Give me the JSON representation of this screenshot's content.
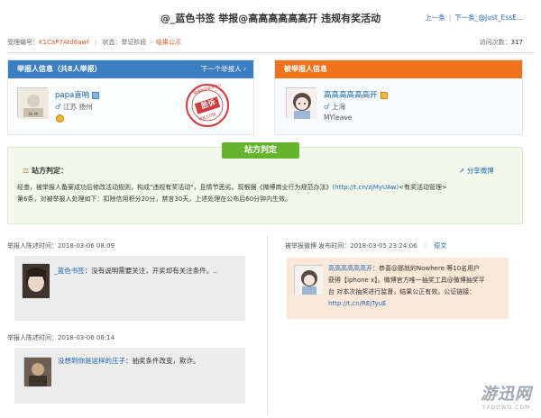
{
  "header": {
    "title": "@_蓝色书签 举报@高高高高高高开 违规有奖活动",
    "prev_label": "上一条",
    "next_label": "下一条_@Just_EssE..."
  },
  "meta": {
    "case_id_label": "受理编号：",
    "case_id": "K1CaP7Atd6awf",
    "status_label": "状态：",
    "status_step1": "举证阶段",
    "status_step2": "结果公示",
    "visits_label": "访问次数：",
    "visits_value": "317"
  },
  "reporter": {
    "header": "举报人信息（共8人举报）",
    "next_link": "下一个举报人",
    "name": "papa直呐",
    "location": "江苏 扬州",
    "stamp_text": "胜诉",
    "stamp_ring": "微博社区管理中心",
    "stamp_sub": "WB.COM"
  },
  "reported": {
    "header": "被举报人信息",
    "name": "高高高高高高开",
    "location": "上海",
    "handle": "MYleave"
  },
  "judgment": {
    "tab_label": "站方判定",
    "heading": "站方判定：",
    "share_label": "分享微博",
    "text_line1": "经查，被举报人备案成功后修改活动规则，构成\"违规有奖活动\"，且情节恶劣。现根据《微博商业行为规范办法》",
    "link1": "(http://t.cn/zjMyUAw)",
    "text_line1b": "<有奖活动管理>",
    "text_line2": "第6条，对被举报人处理如下：扣除信用积分20分，禁言30天。上述处理在公布后60分钟内生效。"
  },
  "statements": {
    "reporter_label": "举报人陈述时间：",
    "reporter_items": [
      {
        "time": "2018-03-06 08:09",
        "name": "_蓝色书签",
        "text": "：没有说明需要关注，开奖却有关注条件。.."
      },
      {
        "time": "2018-03-06 08:14",
        "name": "没想到你是这样的庄子",
        "text": "：抽奖条件改变，欺诈。"
      }
    ],
    "weibo_label": "被举报微博 发布时间：",
    "weibo_time": "2018-03-05 23:24:06",
    "weibo_original": "原文",
    "weibo_name": "高高高高高高开",
    "weibo_text1": "：恭喜@那就的Nowhere 等10名用户",
    "weibo_text2": "获得【iphone x】。微博官方唯一抽奖工具@微博抽奖平",
    "weibo_text3": "台 对本次抽奖进行监督，结果公正有效。公证链接：",
    "weibo_link": "http://t.cn/REjTyuE"
  },
  "watermark": {
    "cn": "游迅网",
    "en": "YXDOWN.COM"
  }
}
